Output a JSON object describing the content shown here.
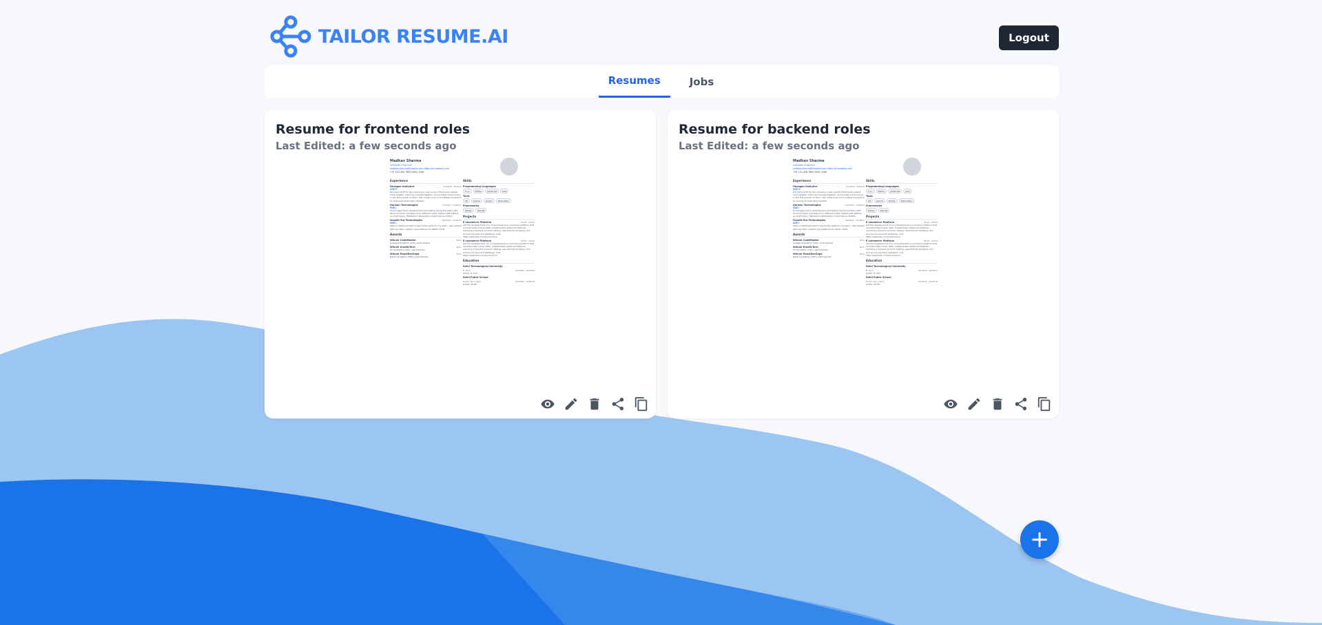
{
  "header": {
    "brand": "TAILOR RESUME.AI",
    "logout_label": "Logout"
  },
  "tabs": [
    {
      "label": "Resumes",
      "active": true
    },
    {
      "label": "Jobs",
      "active": false
    }
  ],
  "resumes": [
    {
      "title": "Resume for frontend roles",
      "last_edited": "Last Edited: a few seconds ago"
    },
    {
      "title": "Resume for backend roles",
      "last_edited": "Last Edited: a few seconds ago"
    }
  ],
  "preview": {
    "name": "Madhav Sharma",
    "role": "Software Engineer",
    "contact": "madhav.sharma@magine.com https://m-madhav.com",
    "phone": "+91 123-456-7890 Delhi, India",
    "experience_heading": "Experience",
    "skills_heading": "Skills",
    "projects_heading": "Projects",
    "education_heading": "Education",
    "awards_heading": "Awards",
    "exp": [
      {
        "company": "Hexagon Analytics",
        "title": "SDE II",
        "dates": "01/2024 - Present",
        "text": "Did some stuff for the company's main product that kinda helped some wealthy folks buy licenses together, and it made some money in the first quarter of 2021. Also made a bunch of software programs by looking at what users wanted."
      },
      {
        "company": "Horizon Technologies",
        "title": "SDE I",
        "dates": "01/2023 - 12/2023",
        "text": "Encouraged some development and testing during the SDLC with about 10 team members from different areas. Helped with setting up Cold Fusion, WebSearch Workstation Client Server Edition."
      },
      {
        "company": "Growth Era Technologies",
        "title": "SDE I",
        "dates": "06/2022 - 12/2022",
        "text": "Made a dashboard which was kinda useful for my team - also worked with big data, created new pipelines for better CI/CD."
      }
    ],
    "awards": [
      {
        "name": "Winner CodeMaster",
        "year": "2022",
        "note": "College hackathon (100+ participants)"
      },
      {
        "name": "Winner KinetiсTech",
        "year": "2021",
        "note": "IIT hackathon (150+ participants)"
      },
      {
        "name": "Winner ReactDevSaga",
        "year": "2021",
        "note": "React hackathon (500+ participants)"
      }
    ],
    "skill_groups": [
      {
        "name": "Programming Languages",
        "items": [
          "C++",
          "Python",
          "JavaScript",
          "Java"
        ]
      },
      {
        "name": "Tools",
        "items": [
          "Git",
          "Jenkins",
          "Docker",
          "Kubernetes"
        ]
      },
      {
        "name": "Frameworks",
        "items": [
          "Django",
          "ReactJS"
        ]
      }
    ],
    "projects": [
      {
        "name": "E-commerce Platform",
        "dates": "01/22 - 03/22",
        "text": "Led the development of a comprehensive e-commerce platform that revolutionized online retail. Implemented advanced features, including a dynamic product catalog, user-friendly shopping cart, and secure payment gateways. Link: https://example.com/ecommerce"
      },
      {
        "name": "E-commerce Platform",
        "dates": "01/22 - 03/22",
        "text": "Led the development of a comprehensive e-commerce platform that revolutionized online retail. Implemented advanced features, including a dynamic product catalog, user-friendly shopping cart, and secure payment gateways. Link: https://example.com/ecommerce"
      }
    ],
    "education": [
      {
        "name": "Delhi Technological University",
        "degree": "B. Tech",
        "dates": "05/2018 - 06/2022",
        "grade": "Grade: 8.7/10"
      },
      {
        "name": "Delhi Public School",
        "degree": "Senior Secondary",
        "dates": "05/2016 - 03/2018",
        "grade": "Grade: 95.8%"
      }
    ]
  },
  "actions": [
    "eye-icon",
    "pencil-icon",
    "trash-icon",
    "share-icon",
    "copy-icon"
  ],
  "colors": {
    "brand": "#3b82f6",
    "accent": "#2563eb",
    "fab": "#1a73e8",
    "logout_bg": "#1f2733"
  }
}
